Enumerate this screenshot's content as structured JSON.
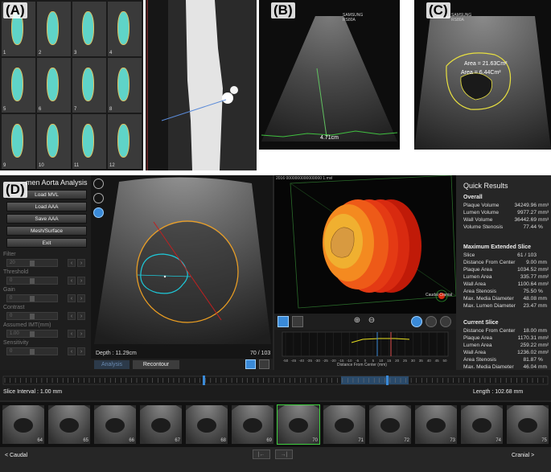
{
  "panels": {
    "a_label": "(A)",
    "b_label": "(B)",
    "c_label": "(C)",
    "d_label": "(D)"
  },
  "ct_slices": [
    "1",
    "2",
    "3",
    "4",
    "5",
    "6",
    "7",
    "8",
    "9",
    "10",
    "11",
    "12"
  ],
  "panel_b": {
    "brand": "SAMSUNG",
    "model": "RS80A",
    "measurement": "4.71cm"
  },
  "panel_c": {
    "brand": "SAMSUNG",
    "model": "RS80A",
    "area_outer": "Area = 21.63Cm²",
    "area_inner": "Area = 6.44Cm²"
  },
  "app": {
    "title": "men Aorta Analysis",
    "file_header": "2016 0000000000000000 1.mvl"
  },
  "menu": {
    "load_mvl": "Load MVL",
    "load_aaa": "Load AAA",
    "save_aaa": "Save AAA",
    "mesh_surface": "Mesh/Surface",
    "exit": "Exit"
  },
  "params": [
    {
      "label": "Filter",
      "value": "20"
    },
    {
      "label": "Threshold",
      "value": "0"
    },
    {
      "label": "Gain",
      "value": "0"
    },
    {
      "label": "Contrast",
      "value": "0"
    },
    {
      "label": "Assumed IMT(mm)",
      "value": "1.00"
    },
    {
      "label": "Sensitivity",
      "value": "0"
    }
  ],
  "viewer": {
    "depth": "Depth : 11.29cm",
    "frame": "70 / 103",
    "analysis_tab": "Analysis",
    "recontour_tab": "Recontour"
  },
  "render": {
    "orientation_label": "Caudal  Cranial"
  },
  "profile_chart": {
    "x_axis_label": "Distance From Center (mm)",
    "x_ticks": [
      "-50",
      "-45",
      "-40",
      "-35",
      "-30",
      "-25",
      "-20",
      "-15",
      "-10",
      "-5",
      "0",
      "5",
      "10",
      "15",
      "20",
      "25",
      "30",
      "35",
      "40",
      "45",
      "50"
    ]
  },
  "quick_results": {
    "title": "Quick Results",
    "overall_heading": "Overall",
    "overall": [
      {
        "label": "Plaque Volume",
        "value": "34249.96",
        "unit": "mm³"
      },
      {
        "label": "Lumen Volume",
        "value": "9977.27",
        "unit": "mm³"
      },
      {
        "label": "Wall Volume",
        "value": "36442.69",
        "unit": "mm³"
      },
      {
        "label": "Volume Stenosis",
        "value": "77.44",
        "unit": "%"
      }
    ],
    "max_heading": "Maximum Extended Slice",
    "max": [
      {
        "label": "Slice",
        "value": "61 / 103",
        "unit": ""
      },
      {
        "label": "Distance From Center",
        "value": "9.00",
        "unit": "mm"
      },
      {
        "label": "Plaque Area",
        "value": "1034.52",
        "unit": "mm²"
      },
      {
        "label": "Lumen Area",
        "value": "335.77",
        "unit": "mm²"
      },
      {
        "label": "Wall Area",
        "value": "1100.64",
        "unit": "mm²"
      },
      {
        "label": "Area Stenosis",
        "value": "75.50",
        "unit": "%"
      },
      {
        "label": "Max. Media Diameter",
        "value": "48.08",
        "unit": "mm"
      },
      {
        "label": "Max. Lumen Diameter",
        "value": "23.47",
        "unit": "mm"
      }
    ],
    "current_heading": "Current Slice",
    "current": [
      {
        "label": "Distance From Center",
        "value": "18.00",
        "unit": "mm"
      },
      {
        "label": "Plaque Area",
        "value": "1170.31",
        "unit": "mm²"
      },
      {
        "label": "Lumen Area",
        "value": "259.22",
        "unit": "mm²"
      },
      {
        "label": "Wall Area",
        "value": "1236.02",
        "unit": "mm²"
      },
      {
        "label": "Area Stenosis",
        "value": "81.87",
        "unit": "%"
      },
      {
        "label": "Max. Media Diameter",
        "value": "46.04",
        "unit": "mm"
      },
      {
        "label": "Max. Lumen Diameter",
        "value": "20.43",
        "unit": "mm"
      }
    ]
  },
  "timeline": {
    "slice_interval": "Slice Interval : 1.00 mm",
    "length": "Length : 102.68 mm"
  },
  "thumbnails": [
    "64",
    "65",
    "66",
    "67",
    "68",
    "69",
    "70",
    "71",
    "72",
    "73",
    "74",
    "75"
  ],
  "selected_thumbnail": "70",
  "bottom": {
    "caudal": "< Caudal",
    "cranial": "Cranial >",
    "prev_icon": "|←",
    "next_icon": "→|"
  },
  "colors": {
    "lumen_contour": "#1ec8d8",
    "media_contour": "#f0a020",
    "accent_blue": "#3a8ad8",
    "plaque_red": "#d22a10"
  }
}
